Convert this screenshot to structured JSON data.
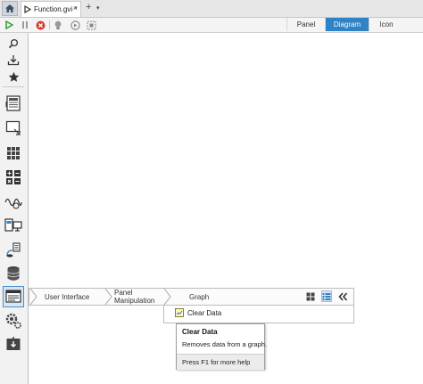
{
  "tab_bar": {
    "document_tab": {
      "title": "Function.gvi *",
      "close_label": "×"
    },
    "add_label": "+",
    "menu_label": "▾"
  },
  "view_tabs": [
    {
      "label": "Panel",
      "active": false
    },
    {
      "label": "Diagram",
      "active": true
    },
    {
      "label": "Icon",
      "active": false
    }
  ],
  "palette": {
    "items": [
      "search-icon",
      "import-icon",
      "favorites-star-icon",
      "numeric-icon",
      "boolean-icon",
      "array-icon",
      "comparison-icon",
      "signal-icon",
      "hardware-icon",
      "data-communication-icon",
      "file-io-icon",
      "user-interface-icon",
      "gear-settings-icon",
      "application-control-icon"
    ]
  },
  "breadcrumb": {
    "items": [
      "User Interface",
      "Panel Manipulation",
      "Graph"
    ]
  },
  "palette_contents": {
    "item": {
      "label": "Clear Data",
      "icon": "clear-data-icon"
    }
  },
  "tooltip": {
    "title": "Clear Data",
    "description": "Removes data from a graph.",
    "help": "Press F1 for more help"
  },
  "colors": {
    "accent": "#2f82c3",
    "run_green": "#2e9b3b",
    "abort_red": "#d63b2f"
  }
}
